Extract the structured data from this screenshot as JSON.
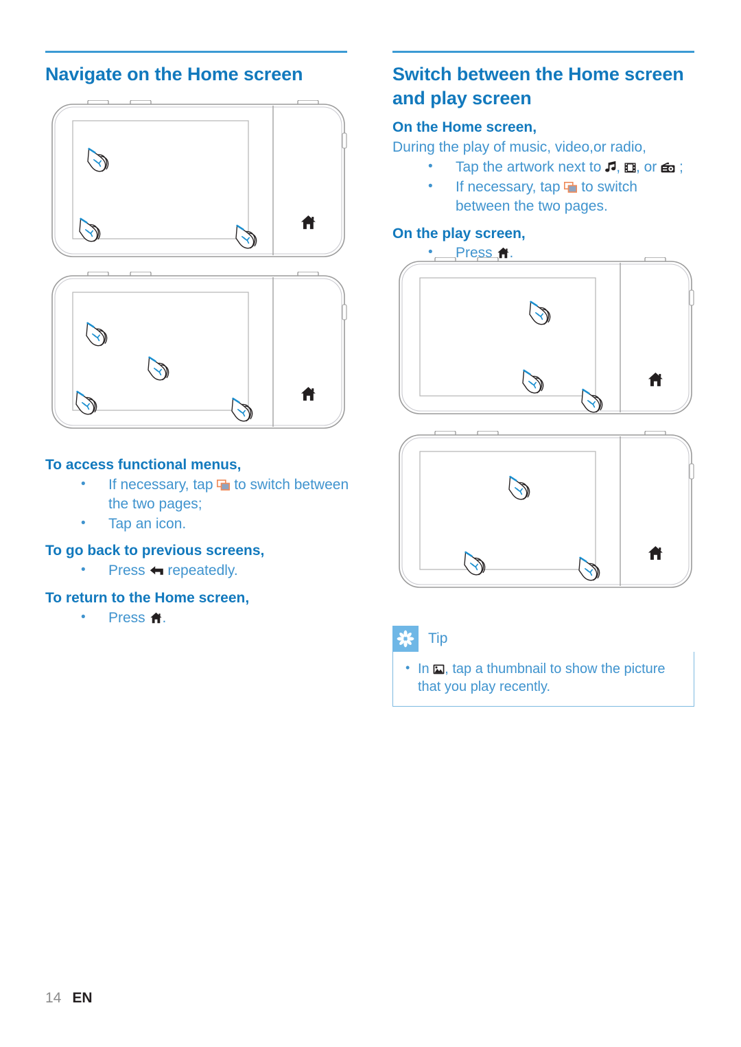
{
  "page": {
    "number": "14",
    "language": "EN"
  },
  "left_column": {
    "heading": "Navigate on the Home screen",
    "illustrations": [
      {
        "name": "device-home-screen-first-page",
        "home_icon": "home-icon",
        "touch_points": 3
      },
      {
        "name": "device-home-screen-second-page",
        "home_icon": "home-icon",
        "touch_points": 4
      }
    ],
    "sections": [
      {
        "title": "To access functional menus,",
        "bullets": [
          {
            "parts": [
              {
                "type": "text",
                "value": "If necessary, tap "
              },
              {
                "type": "icon",
                "value": "switch-pages-icon"
              },
              {
                "type": "text",
                "value": " to switch between the two pages;"
              }
            ],
            "plain": "If necessary, tap  to switch between the two pages;"
          },
          {
            "parts": [
              {
                "type": "text",
                "value": "Tap an icon."
              }
            ],
            "plain": "Tap an icon."
          }
        ]
      },
      {
        "title": "To go back to previous screens,",
        "bullets": [
          {
            "parts": [
              {
                "type": "text",
                "value": "Press "
              },
              {
                "type": "icon",
                "value": "back-arrow-icon"
              },
              {
                "type": "text",
                "value": " repeatedly."
              }
            ],
            "plain": "Press  repeatedly."
          }
        ]
      },
      {
        "title": "To return to the Home screen,",
        "bullets": [
          {
            "parts": [
              {
                "type": "text",
                "value": "Press "
              },
              {
                "type": "icon",
                "value": "home-icon"
              },
              {
                "type": "text",
                "value": "."
              }
            ],
            "plain": "Press ."
          }
        ]
      }
    ]
  },
  "right_column": {
    "heading": "Switch between the Home screen and play screen",
    "subheading_1": "On the Home screen,",
    "intro": "During the play of music, video,or radio,",
    "bullets_1": [
      {
        "prefix": "Tap the artwork next to ",
        "icons": [
          "music-note-icon",
          "film-icon",
          "radio-icon"
        ],
        "separator_1": ", ",
        "separator_2": ", or ",
        "suffix": " ;"
      },
      {
        "prefix": "If necessary, tap ",
        "icon": "switch-pages-icon",
        "suffix": " to switch between the two pages."
      }
    ],
    "subheading_2": "On the play screen,",
    "bullets_2": [
      {
        "prefix": "Press ",
        "icon": "home-icon",
        "suffix": "."
      }
    ],
    "illustrations": [
      {
        "name": "device-play-screen-top",
        "home_icon": "home-icon",
        "touch_points": 3
      },
      {
        "name": "device-play-screen-bottom",
        "home_icon": "home-icon",
        "touch_points": 3
      }
    ]
  },
  "tip": {
    "badge_icon": "asterisk-icon",
    "label": "Tip",
    "bullets": [
      {
        "prefix": "In ",
        "icon": "picture-icon",
        "suffix": ", tap a thumbnail to show the picture that you play recently."
      }
    ]
  },
  "colors": {
    "heading_blue": "#1279bd",
    "body_blue": "#3f93ce",
    "rule_blue": "#3b9ad4",
    "tip_badge_blue": "#6fb7e6",
    "tip_border_blue": "#7cb9e0",
    "icon_orange": "#ef8b5a",
    "icon_dark": "#231f20"
  }
}
